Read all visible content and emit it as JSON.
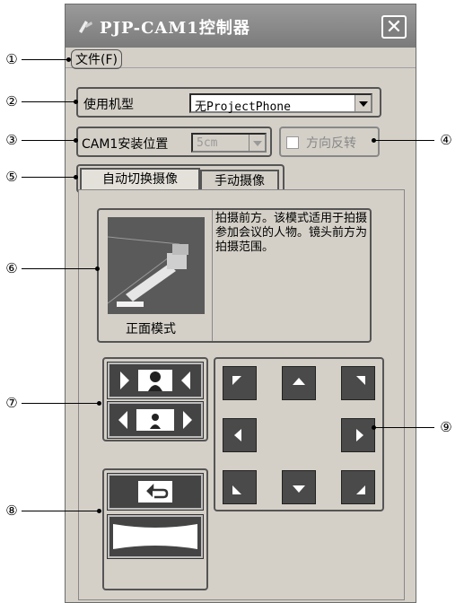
{
  "window": {
    "title": "PJP-CAM1控制器",
    "close_glyph": "✕"
  },
  "menu": {
    "file": "文件(F)"
  },
  "model": {
    "label": "使用机型",
    "value": "无ProjectPhone"
  },
  "install": {
    "label": "CAM1安装位置",
    "value": "5cm"
  },
  "flip": {
    "label": "方向反转",
    "checked": false
  },
  "tabs": [
    {
      "label": "自动切换摄像",
      "active": true
    },
    {
      "label": "手动摄像",
      "active": false
    }
  ],
  "mode": {
    "name": "正面模式",
    "description": "拍摄前方。该模式适用于拍摄参加会议的人物。镜头前方为拍摄范围。"
  },
  "callouts": [
    "①",
    "②",
    "③",
    "④",
    "⑤",
    "⑥",
    "⑦",
    "⑧",
    "⑨"
  ],
  "icons": {
    "app": "camera-app-icon",
    "zoom_in": "zoom-in-person-icon",
    "zoom_out": "zoom-out-person-icon",
    "rotate": "rotate-return-icon",
    "wide": "panorama-icon"
  },
  "colors": {
    "title_bg": "#8a8a8a",
    "window_bg": "#d4d0c8",
    "button_dark": "#444444"
  }
}
